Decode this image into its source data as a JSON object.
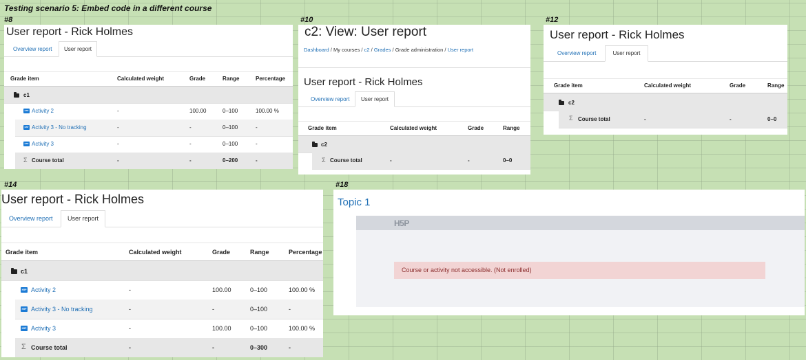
{
  "scenario_title": "Testing scenario 5: Embed code in a different course",
  "panel_labels": {
    "p8": "#8",
    "p10": "#10",
    "p12": "#12",
    "p14": "#14",
    "p18": "#18"
  },
  "report_title": "User report - Rick Holmes",
  "c2_title": "c2: View: User report",
  "tabs": {
    "overview": "Overview report",
    "user": "User report"
  },
  "breadcrumb": [
    "Dashboard",
    "My courses",
    "c2",
    "Grades",
    "Grade administration",
    "User report"
  ],
  "breadcrumb_sep": "/",
  "columns": {
    "item": "Grade item",
    "weight": "Calculated weight",
    "grade": "Grade",
    "range": "Range",
    "percentage": "Percentage"
  },
  "course_c1": {
    "category": "c1",
    "total_label": "Course total",
    "rows_p8": [
      {
        "name": "Activity 2",
        "weight": "-",
        "grade": "100.00",
        "range": "0–100",
        "percentage": "100.00 %"
      },
      {
        "name": "Activity 3 - No tracking",
        "weight": "-",
        "grade": "-",
        "range": "0–100",
        "percentage": "-"
      },
      {
        "name": "Activity 3",
        "weight": "-",
        "grade": "-",
        "range": "0–100",
        "percentage": "-"
      }
    ],
    "total_p8": {
      "weight": "-",
      "grade": "-",
      "range": "0–200",
      "percentage": "-"
    },
    "rows_p14": [
      {
        "name": "Activity 2",
        "weight": "-",
        "grade": "100.00",
        "range": "0–100",
        "percentage": "100.00 %"
      },
      {
        "name": "Activity 3 - No tracking",
        "weight": "-",
        "grade": "-",
        "range": "0–100",
        "percentage": "-"
      },
      {
        "name": "Activity 3",
        "weight": "-",
        "grade": "100.00",
        "range": "0–100",
        "percentage": "100.00 %"
      }
    ],
    "total_p14": {
      "weight": "-",
      "grade": "-",
      "range": "0–300",
      "percentage": "-"
    }
  },
  "course_c2": {
    "category": "c2",
    "total_label": "Course total",
    "total": {
      "weight": "-",
      "grade": "-",
      "range": "0–0"
    }
  },
  "topic": {
    "title": "Topic 1",
    "logo": "H5P",
    "error": "Course or activity not accessible. (Not enrolled)"
  },
  "h5p_icon_text": "H5P",
  "sigma": "Σ",
  "colors": {
    "link": "#1f6fb5",
    "error_bg": "#f2d4d4",
    "error_text": "#8a2b2b",
    "background": "#c6e0b4"
  }
}
